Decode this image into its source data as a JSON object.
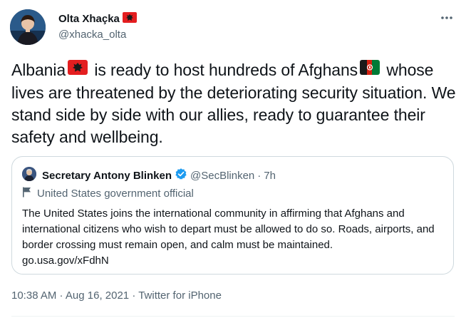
{
  "author": {
    "name": "Olta Xhaçka",
    "handle": "@xhacka_olta",
    "name_flag_icon": "albania-flag-icon"
  },
  "more_icon": "more-dots-icon",
  "tweet": {
    "text_part1": "Albania",
    "text_part2": " is ready to host hundreds of Afghans",
    "text_part3": " whose lives are threatened by the deteriorating security situation. We stand side by side with our allies, ready to guarantee their safety and wellbeing.",
    "flag_icons": [
      "albania-flag-icon",
      "afghanistan-flag-icon"
    ]
  },
  "quoted_tweet": {
    "name": "Secretary Antony Blinken",
    "handle": "@SecBlinken",
    "separator": "·",
    "time": "7h",
    "label": "United States government official",
    "label_icon": "flag-outline-icon",
    "verified_icon": "verified-badge-icon",
    "body": "The United States joins the international community in affirming that Afghans and international citizens who wish to depart must be allowed to do so. Roads, airports, and border crossing must remain open, and calm must be maintained.",
    "link": "go.usa.gov/xFdhN"
  },
  "footer": {
    "time": "10:38 AM",
    "sep1": " · ",
    "date": "Aug 16, 2021",
    "sep2": " · ",
    "source": "Twitter for iPhone"
  },
  "colors": {
    "text": "#0f1419",
    "secondary": "#536471",
    "border": "#cfd9de",
    "verified": "#1d9bf0",
    "albania_red": "#e41e20"
  }
}
